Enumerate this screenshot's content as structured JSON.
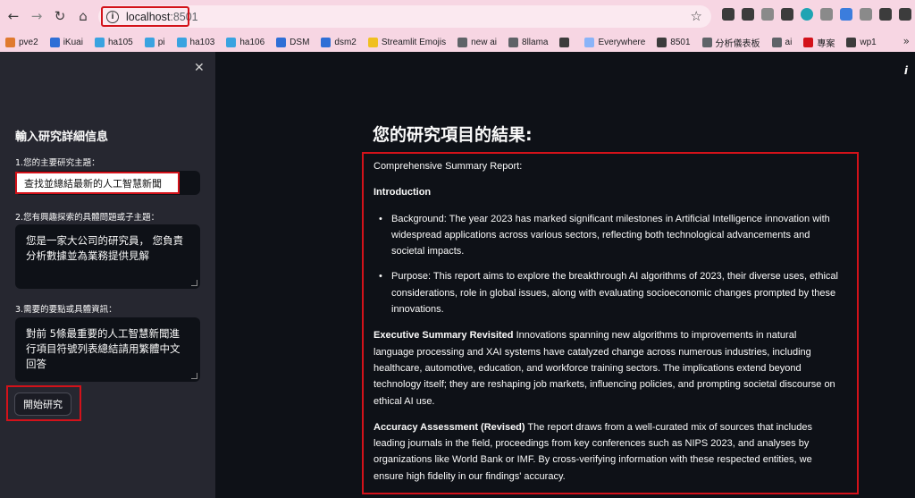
{
  "browser": {
    "url_host": "localhost",
    "url_port": ":8501",
    "bookmarks": [
      {
        "label": "pve2",
        "color": "#e07a2e"
      },
      {
        "label": "iKuai",
        "color": "#2f6fd6"
      },
      {
        "label": "ha105",
        "color": "#3aa3e0"
      },
      {
        "label": "pi",
        "color": "#3aa3e0"
      },
      {
        "label": "ha103",
        "color": "#3aa3e0"
      },
      {
        "label": "ha106",
        "color": "#3aa3e0"
      },
      {
        "label": "DSM",
        "color": "#2f6fd6"
      },
      {
        "label": "dsm2",
        "color": "#2f6fd6"
      },
      {
        "label": "Streamlit Emojis",
        "color": "#f0c020"
      },
      {
        "label": "new ai",
        "color": "#5f6368"
      },
      {
        "label": "8llama",
        "color": "#5f6368"
      },
      {
        "label": "",
        "color": "#3c3c3c"
      },
      {
        "label": "Everywhere",
        "color": "#8ab4f8"
      },
      {
        "label": "8501",
        "color": "#3c3c3c"
      },
      {
        "label": "分析儀表板",
        "color": "#5f6368"
      },
      {
        "label": "ai",
        "color": "#5f6368"
      },
      {
        "label": "專案",
        "color": "#d3121a"
      },
      {
        "label": "wp1",
        "color": "#3c3c3c"
      }
    ]
  },
  "sidebar": {
    "title": "輸入研究詳細信息",
    "topic_label": "1.您的主要研究主題：",
    "topic_value": "查找並總結最新的人工智慧新聞",
    "sub_label": "2.您有興趣探索的具體問題或子主題：",
    "sub_value": "您是一家大公司的研究員， 您負責分析數據並為業務提供見解",
    "details_label": "3.需要的要點或具體資訊：",
    "details_value": "對前 5條最重要的人工智慧新聞進行項目符號列表總結請用繁體中文回答",
    "start_button": "開始研究"
  },
  "main": {
    "title": "您的研究項目的結果:",
    "report": {
      "heading": "Comprehensive Summary Report:",
      "intro_title": "Introduction",
      "bullets": [
        "Background: The year 2023 has marked significant milestones in Artificial Intelligence innovation with widespread applications across various sectors, reflecting both technological advancements and societal impacts.",
        "Purpose: This report aims to explore the breakthrough AI algorithms of 2023, their diverse uses, ethical considerations, role in global issues, along with evaluating socioeconomic changes prompted by these innovations."
      ],
      "exec_title": "Executive Summary Revisited",
      "exec_text": " Innovations spanning new algorithms to improvements in natural language processing and XAI systems have catalyzed change across numerous industries, including healthcare, automotive, education, and workforce training sectors. The implications extend beyond technology itself; they are reshaping job markets, influencing policies, and prompting societal discourse on ethical AI use.",
      "acc_title": "Accuracy Assessment (Revised)",
      "acc_text": " The report draws from a well-curated mix of sources that includes leading journals in the field, proceedings from key conferences such as NIPS 2023, and analyses by organizations like World Bank or IMF. By cross-verifying information with these respected entities, we ensure high fidelity in our findings' accuracy."
    }
  }
}
